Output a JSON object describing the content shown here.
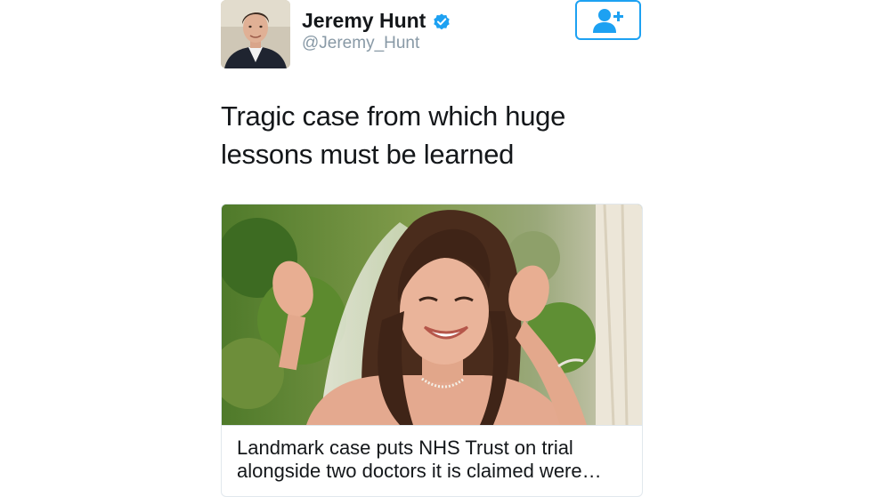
{
  "author": {
    "display_name": "Jeremy Hunt",
    "handle": "@Jeremy_Hunt",
    "verified_icon": "verified-badge-icon",
    "avatar_icon": "profile-photo"
  },
  "follow_button": {
    "icon": "add-user-icon"
  },
  "tweet": {
    "text_line_1": "Tragic case from which huge",
    "text_line_2": "lessons must be learned"
  },
  "link_card": {
    "image_icon": "article-photo",
    "title_line_1": "Landmark case puts NHS Trust on trial",
    "title_line_2": "alongside two doctors it is claimed were…"
  },
  "colors": {
    "accent": "#1da1f2",
    "handle_gray": "#8899a6",
    "text": "#14171a",
    "border": "#e1e8ed"
  }
}
